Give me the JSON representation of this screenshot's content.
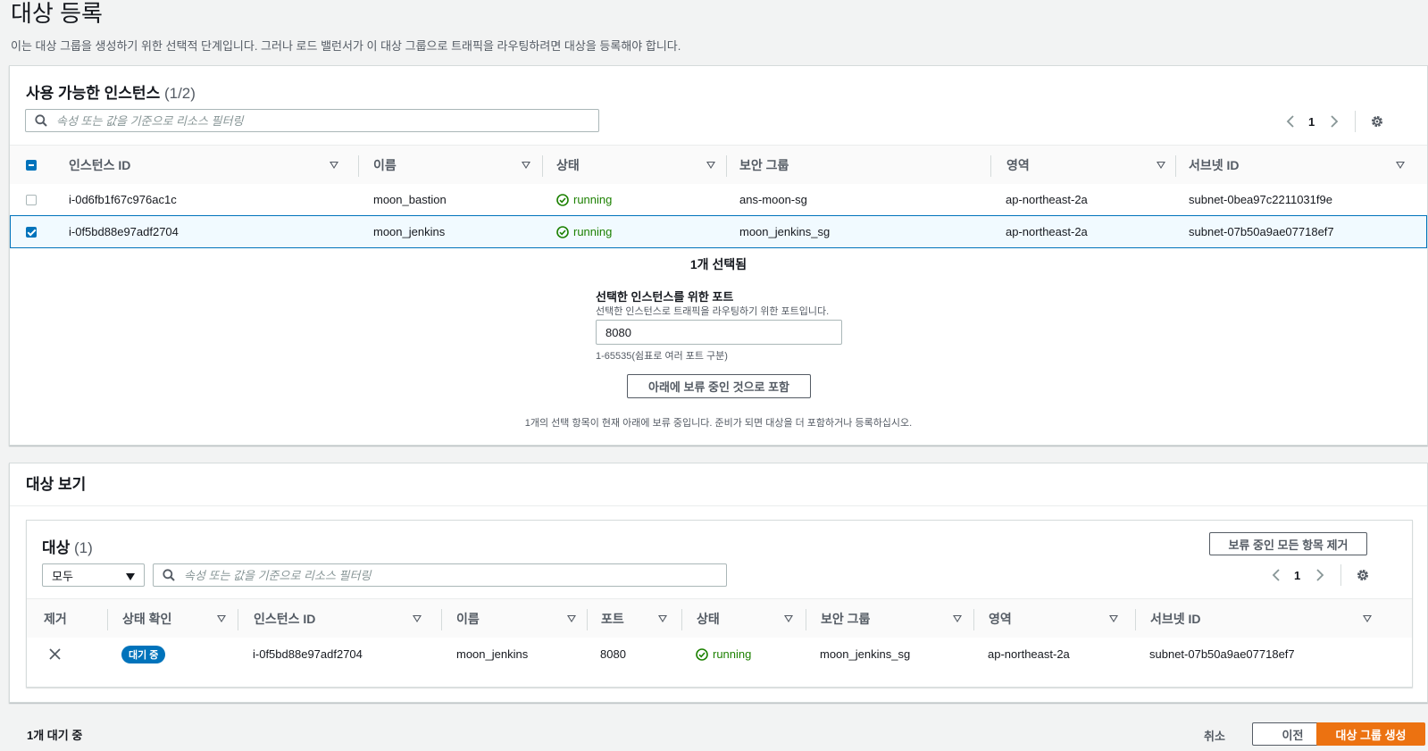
{
  "page": {
    "title": "대상 등록",
    "description": "이는 대상 그룹을 생성하기 위한 선택적 단계입니다. 그러나 로드 밸런서가 이 대상 그룹으로 트래픽을 라우팅하려면 대상을 등록해야 합니다."
  },
  "available": {
    "title": "사용 가능한 인스턴스",
    "count": "(1/2)",
    "search_placeholder": "속성 또는 값을 기준으로 리소스 필터링",
    "page_number": "1",
    "columns": [
      "인스턴스 ID",
      "이름",
      "상태",
      "보안 그룹",
      "영역",
      "서브넷 ID"
    ],
    "rows": [
      {
        "id": "i-0d6fb1f67c976ac1c",
        "name": "moon_bastion",
        "state": "running",
        "sg": "ans-moon-sg",
        "zone": "ap-northeast-2a",
        "subnet": "subnet-0bea97c2211031f9e",
        "selected": false
      },
      {
        "id": "i-0f5bd88e97adf2704",
        "name": "moon_jenkins",
        "state": "running",
        "sg": "moon_jenkins_sg",
        "zone": "ap-northeast-2a",
        "subnet": "subnet-07b50a9ae07718ef7",
        "selected": true
      }
    ],
    "selected_count": "1개 선택됨",
    "port_label": "선택한 인스턴스를 위한 포트",
    "port_description": "선택한 인스턴스로 트래픽을 라우팅하기 위한 포트입니다.",
    "port_value": "8080",
    "port_hint": "1-65535(쉼표로 여러 포트 구분)",
    "include_button": "아래에 보류 중인 것으로 포함",
    "pending_note": "1개의 선택 항목이 현재 아래에 보류 중입니다. 준비가 되면 대상을 더 포함하거나 등록하십시오."
  },
  "review": {
    "title": "대상 보기",
    "targets_title": "대상",
    "targets_count": "(1)",
    "remove_all_button": "보류 중인 모든 항목 제거",
    "filter_select": "모두",
    "search_placeholder": "속성 또는 값을 기준으로 리소스 필터링",
    "page_number": "1",
    "columns": [
      "제거",
      "상태 확인",
      "인스턴스 ID",
      "이름",
      "포트",
      "상태",
      "보안 그룹",
      "영역",
      "서브넷 ID"
    ],
    "rows": [
      {
        "health": "대기 중",
        "id": "i-0f5bd88e97adf2704",
        "name": "moon_jenkins",
        "port": "8080",
        "state": "running",
        "sg": "moon_jenkins_sg",
        "zone": "ap-northeast-2a",
        "subnet": "subnet-07b50a9ae07718ef7"
      }
    ]
  },
  "footer": {
    "pending_summary": "1개 대기 중",
    "cancel": "취소",
    "previous": "이전",
    "create": "대상 그룹 생성"
  },
  "colors": {
    "primary": "#ec7211",
    "selection": "#0073bb",
    "running": "#1d8102"
  }
}
